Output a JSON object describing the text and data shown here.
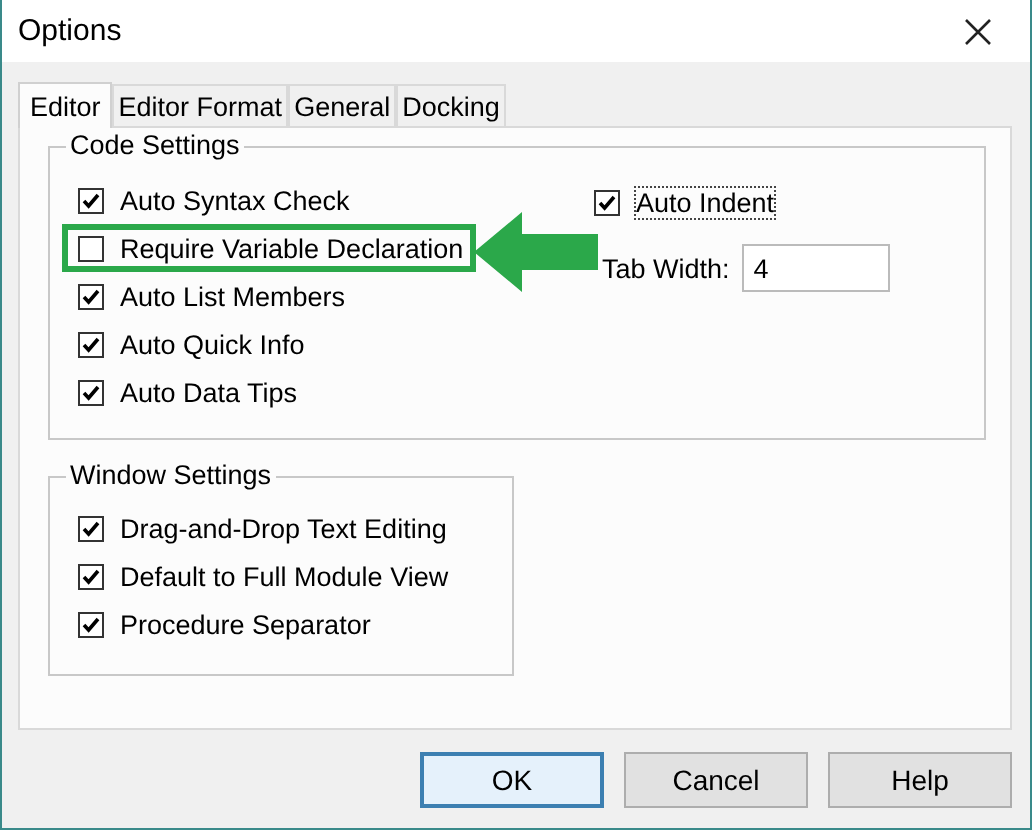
{
  "window": {
    "title": "Options"
  },
  "tabs": [
    {
      "label": "Editor",
      "selected": true
    },
    {
      "label": "Editor Format",
      "selected": false
    },
    {
      "label": "General",
      "selected": false
    },
    {
      "label": "Docking",
      "selected": false
    }
  ],
  "code_settings": {
    "title": "Code Settings",
    "options": [
      {
        "label": "Auto Syntax Check",
        "checked": true,
        "highlighted": false
      },
      {
        "label": "Require Variable Declaration",
        "checked": false,
        "highlighted": true
      },
      {
        "label": "Auto List Members",
        "checked": true,
        "highlighted": false
      },
      {
        "label": "Auto Quick Info",
        "checked": true,
        "highlighted": false
      },
      {
        "label": "Auto Data Tips",
        "checked": true,
        "highlighted": false
      }
    ],
    "auto_indent": {
      "label": "Auto Indent",
      "checked": true,
      "focused": true
    },
    "tab_width": {
      "label": "Tab Width:",
      "value": "4"
    }
  },
  "window_settings": {
    "title": "Window Settings",
    "options": [
      {
        "label": "Drag-and-Drop Text Editing",
        "checked": true
      },
      {
        "label": "Default to Full Module View",
        "checked": true
      },
      {
        "label": "Procedure Separator",
        "checked": true
      }
    ]
  },
  "buttons": [
    {
      "label": "OK",
      "default": true
    },
    {
      "label": "Cancel",
      "default": false
    },
    {
      "label": "Help",
      "default": false
    }
  ]
}
